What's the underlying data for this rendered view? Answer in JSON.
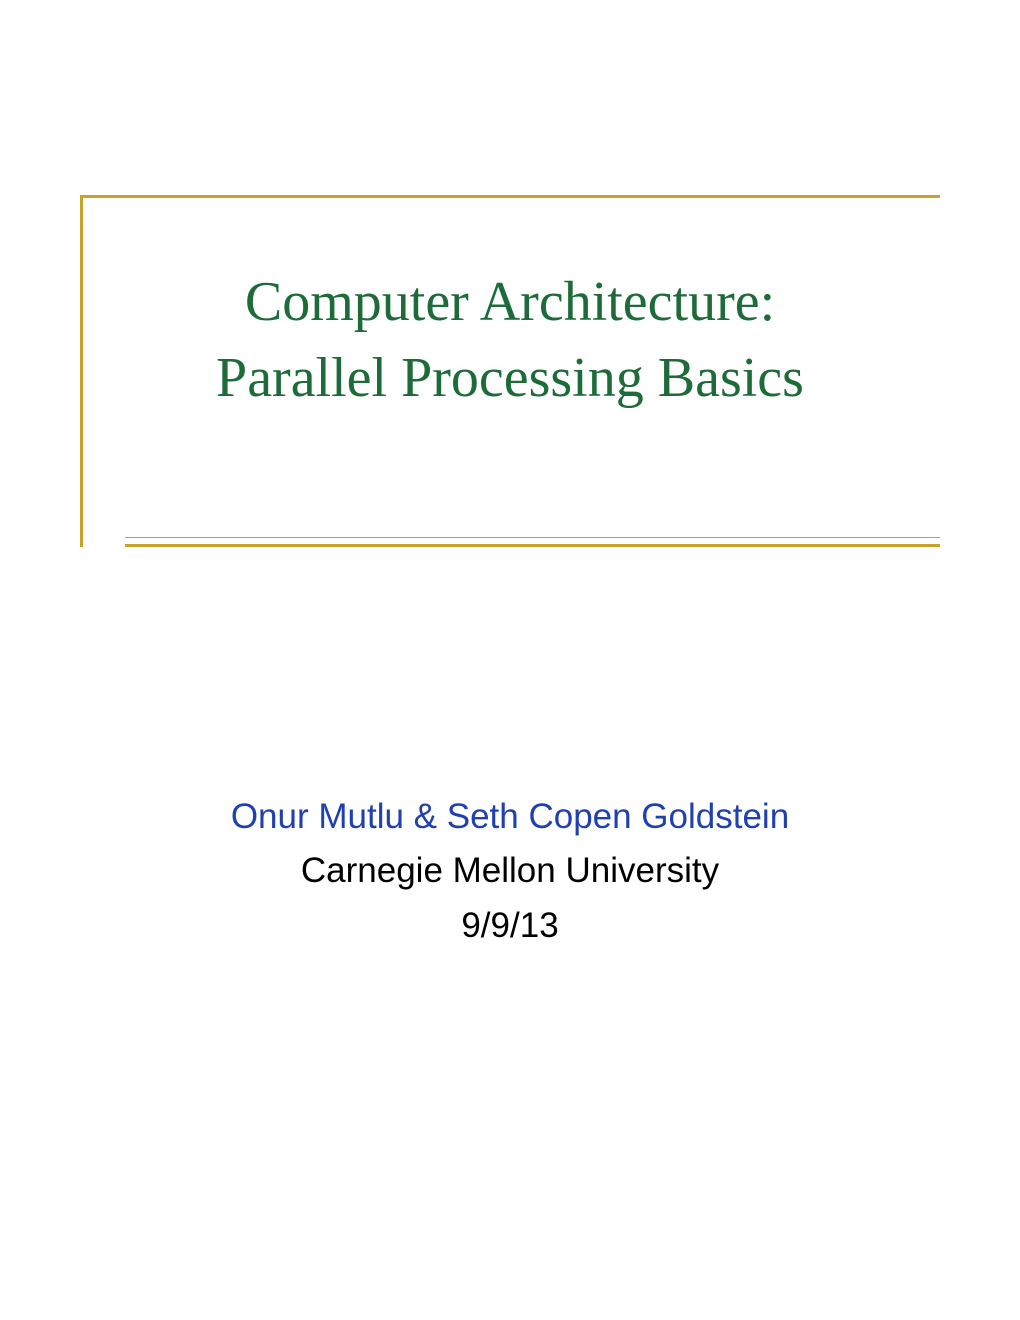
{
  "slide": {
    "title_line1": "Computer Architecture:",
    "title_line2": "Parallel Processing Basics",
    "authors": "Onur Mutlu & Seth Copen Goldstein",
    "affiliation": "Carnegie Mellon University",
    "date": "9/9/13"
  },
  "colors": {
    "title_text": "#1e6b3a",
    "authors_text": "#2040b0",
    "frame": "#c9a227"
  }
}
